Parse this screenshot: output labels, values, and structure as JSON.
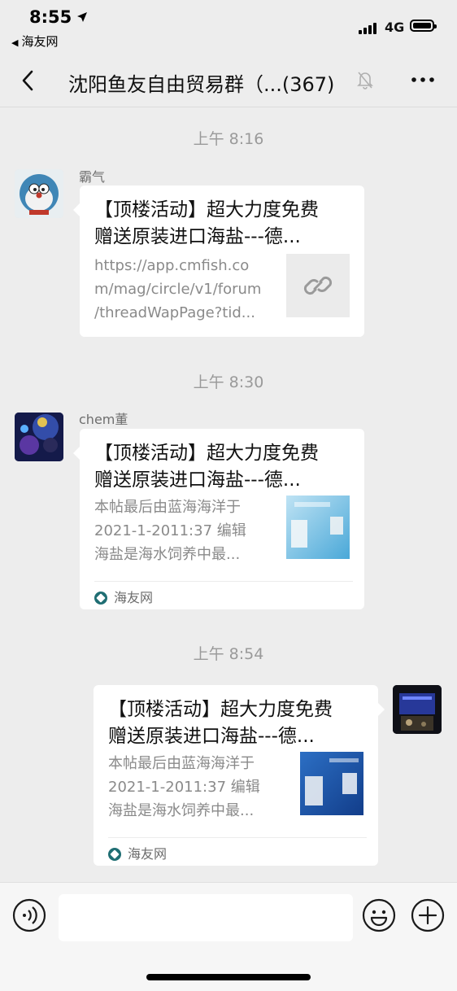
{
  "status": {
    "time": "8:55",
    "location_icon": "location-arrow-icon",
    "back_app": "海友网",
    "network": "4G"
  },
  "nav": {
    "title": "沈阳鱼友自由贸易群（...(367)",
    "muted": true
  },
  "messages": [
    {
      "timestamp": "上午 8:16",
      "sender": "霸气",
      "side": "left",
      "title_lines": [
        "【顶楼活动】超大力度免费",
        "赠送原装进口海盐---德..."
      ],
      "desc_lines": [
        "https://app.cmfish.co",
        "m/mag/circle/v1/forum",
        "/threadWapPage?tid..."
      ],
      "thumb": "link-icon",
      "source": ""
    },
    {
      "timestamp": "上午 8:30",
      "sender": "chem董",
      "side": "left",
      "title_lines": [
        "【顶楼活动】超大力度免费",
        "赠送原装进口海盐---德..."
      ],
      "desc_lines": [
        "本帖最后由蓝海海洋于",
        "2021-1-2011:37 编辑",
        "海盐是海水饲养中最..."
      ],
      "thumb": "preview-image",
      "source": "海友网"
    },
    {
      "timestamp": "上午 8:54",
      "sender": "",
      "side": "right",
      "title_lines": [
        "【顶楼活动】超大力度免费",
        "赠送原装进口海盐---德..."
      ],
      "desc_lines": [
        "本帖最后由蓝海海洋于",
        "2021-1-2011:37 编辑",
        "海盐是海水饲养中最..."
      ],
      "thumb": "preview-image",
      "source": "海友网"
    }
  ],
  "colors": {
    "background": "#ededed",
    "bubble": "#ffffff",
    "timestamp": "#9a9a9a",
    "source_logo": "#1f6e73"
  }
}
